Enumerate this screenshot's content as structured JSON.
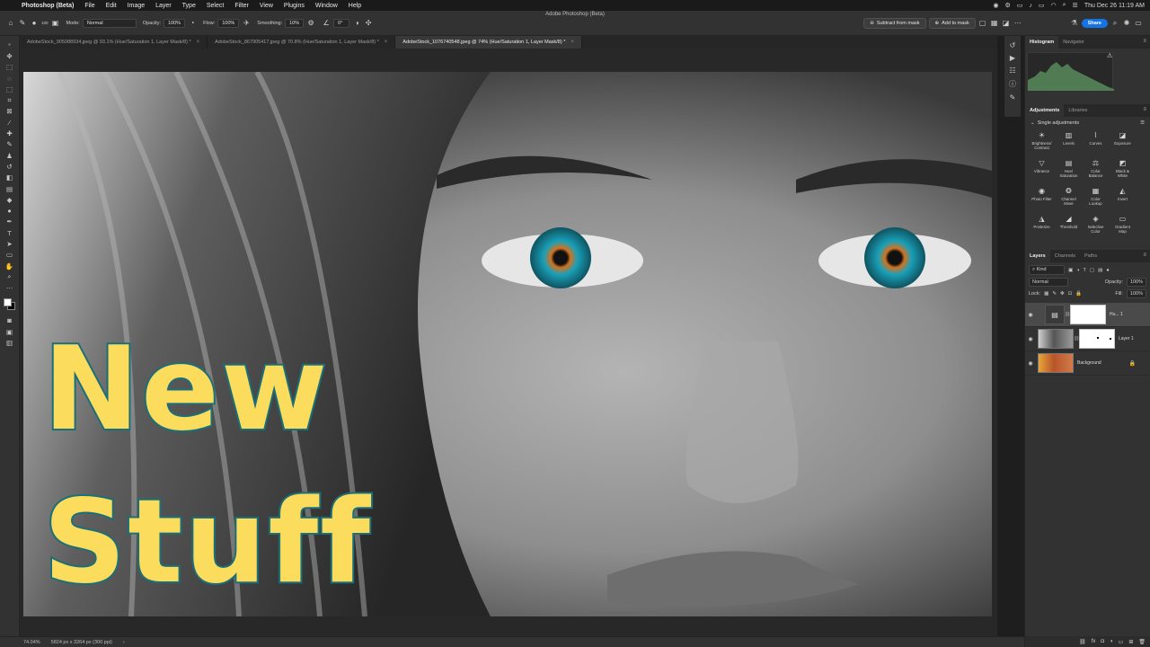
{
  "menubar": {
    "apple_glyph": "",
    "app_name": "Photoshop (Beta)",
    "menus": [
      "File",
      "Edit",
      "Image",
      "Layer",
      "Type",
      "Select",
      "Filter",
      "View",
      "Plugins",
      "Window",
      "Help"
    ],
    "clock": "Thu Dec 26  11:19 AM"
  },
  "window": {
    "title": "Adobe Photoshop (Beta)"
  },
  "options": {
    "brush_size": "100",
    "mode_label": "Mode:",
    "mode_value": "Normal",
    "opacity_label": "Opacity:",
    "opacity_value": "100%",
    "flow_label": "Flow:",
    "flow_value": "100%",
    "smoothing_label": "Smoothing:",
    "smoothing_value": "10%",
    "angle_value": "0°",
    "subtract_mask": "Subtract from mask",
    "add_mask": "Add to mask",
    "share": "Share"
  },
  "tabs": [
    {
      "label": "AdobeStock_905088934.jpeg @ 93.1% (Hue/Saturation 1, Layer Mask/8) *",
      "close": "×"
    },
    {
      "label": "AdobeStock_867905417.jpeg @ 70.8% (Hue/Saturation 1, Layer Mask/8) *",
      "close": "×"
    },
    {
      "label": "AdobeStock_1076740548.jpeg @ 74% (Hue/Saturation 1, Layer Mask/8) *",
      "close": "×"
    }
  ],
  "canvas_text": {
    "line1": "New",
    "line2": "Stuff"
  },
  "status": {
    "zoom": "74.04%",
    "dimensions": "5824 px x 3264 px (300 ppi)",
    "arrow": "›"
  },
  "panels": {
    "histogram_tab": "Histogram",
    "navigator_tab": "Navigator",
    "adjustments_tab": "Adjustments",
    "libraries_tab": "Libraries",
    "single_adjustments": "Single adjustments",
    "adjustments": [
      [
        "Brightness/",
        "Contrast"
      ],
      [
        "Levels",
        ""
      ],
      [
        "Curves",
        ""
      ],
      [
        "Exposure",
        ""
      ],
      [
        "Vibrance",
        ""
      ],
      [
        "Hue/",
        "Saturation"
      ],
      [
        "Color",
        "Balance"
      ],
      [
        "Black &",
        "White"
      ],
      [
        "Photo Filter",
        ""
      ],
      [
        "Channel",
        "Mixer"
      ],
      [
        "Color",
        "Lookup"
      ],
      [
        "Invert",
        ""
      ],
      [
        "Posterize",
        ""
      ],
      [
        "Threshold",
        ""
      ],
      [
        "Selective",
        "Color"
      ],
      [
        "Gradient",
        "Map"
      ]
    ],
    "layers_tab": "Layers",
    "channels_tab": "Channels",
    "paths_tab": "Paths",
    "kind_filter": "Kind",
    "blend_mode": "Normal",
    "opacity_label": "Opacity:",
    "opacity_value": "100%",
    "lock_label": "Lock:",
    "fill_label": "Fill:",
    "fill_value": "100%",
    "layers": [
      {
        "name": "Hu... 1"
      },
      {
        "name": "Layer 1"
      },
      {
        "name": "Background"
      }
    ]
  },
  "colors": {
    "accent": "#1473e6",
    "text_fill": "#fbdc5c",
    "text_stroke": "#1b6f78",
    "iris": "#1aa0b8",
    "iris_center": "#d4721e"
  }
}
